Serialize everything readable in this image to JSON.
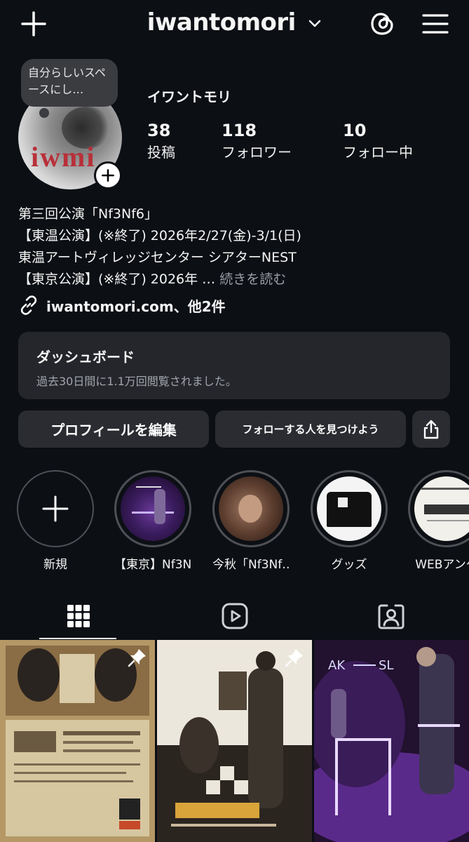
{
  "header": {
    "username": "iwantomori",
    "icons": {
      "add": "plus-icon",
      "switch": "chevron-down-icon",
      "threads": "threads-icon",
      "menu": "hamburger-menu-icon"
    }
  },
  "profile": {
    "note": "自分らしいスペースにし…",
    "display_name": "イワントモリ",
    "stats": [
      {
        "value": "38",
        "label": "投稿"
      },
      {
        "value": "118",
        "label": "フォロワー"
      },
      {
        "value": "10",
        "label": "フォロー中"
      }
    ],
    "bio_lines": [
      "第三回公演「Nf3Nf6」",
      "【東温公演】(※終了) 2026年2/27(金)-3/1(日)",
      "東温アートヴィレッジセンター シアターNEST",
      "【東京公演】(※終了) 2026年"
    ],
    "bio_more": "続きを読む",
    "link": "iwantomori.com、他2件"
  },
  "dashboard": {
    "title": "ダッシュボード",
    "subtitle": "過去30日間に1.1万回閲覧されました。"
  },
  "buttons": {
    "edit": "プロフィールを編集",
    "find": "フォローする人を見つけよう"
  },
  "highlights": [
    {
      "label": "新規"
    },
    {
      "label": "【東京】Nf3N…"
    },
    {
      "label": "今秋「Nf3Nf…"
    },
    {
      "label": "グッズ"
    },
    {
      "label": "WEBアンケ"
    }
  ],
  "colors": {
    "background": "#0c0f14",
    "surface": "#24262b",
    "muted_text": "#9a9da3"
  }
}
